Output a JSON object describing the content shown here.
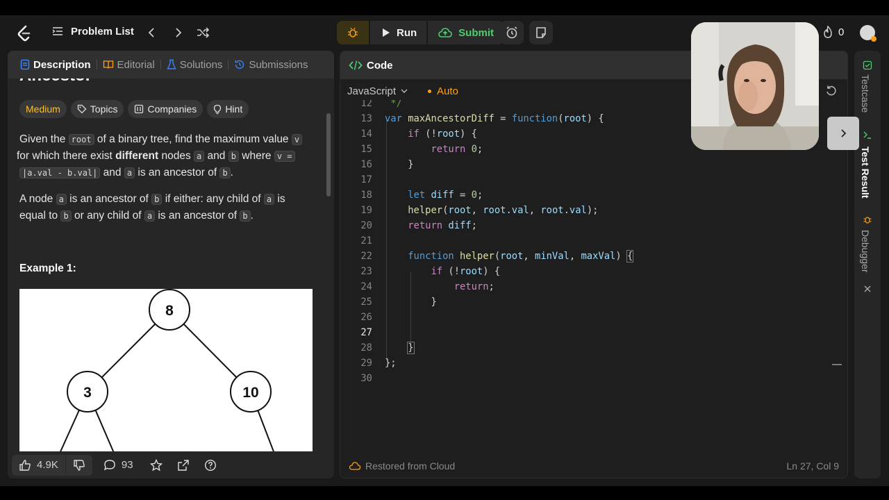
{
  "nav": {
    "problem_list": "Problem List",
    "run": "Run",
    "submit": "Submit",
    "streak": "0"
  },
  "left": {
    "tabs": [
      "Description",
      "Editorial",
      "Solutions",
      "Submissions"
    ],
    "title_partial": "Ancestor",
    "tags": [
      "Medium",
      "Topics",
      "Companies",
      "Hint"
    ],
    "p1": {
      "a": "Given the ",
      "code1": "root",
      "b": " of a binary tree, find the maximum value ",
      "code2": "v",
      "c": " for which there exist ",
      "bold": "different",
      "d": " nodes ",
      "code3": "a",
      "e": " and ",
      "code4": "b",
      "f": " where ",
      "code5": "v =",
      "code6": "|a.val - b.val|",
      "g": " and ",
      "code7": "a",
      "h": " is an ancestor of ",
      "code8": "b",
      "i": "."
    },
    "p2": {
      "a": "A node ",
      "code1": "a",
      "b": " is an ancestor of ",
      "code2": "b",
      "c": " if either: any child of ",
      "code3": "a",
      "d": " is equal to ",
      "code4": "b",
      "e": " or any child of ",
      "code5": "a",
      "f": " is an ancestor of ",
      "code6": "b",
      "g": "."
    },
    "example_label": "Example 1:",
    "tree_nodes": [
      "8",
      "3",
      "10"
    ],
    "footer": {
      "likes": "4.9K",
      "comments": "93"
    }
  },
  "editor": {
    "header": "Code",
    "language": "JavaScript",
    "auto": "Auto",
    "lines": [
      {
        "n": "12",
        "t": " */"
      },
      {
        "n": "13",
        "t": "var maxAncestorDiff = function(root) {"
      },
      {
        "n": "14",
        "t": "    if (!root) {"
      },
      {
        "n": "15",
        "t": "        return 0;"
      },
      {
        "n": "16",
        "t": "    }"
      },
      {
        "n": "17",
        "t": ""
      },
      {
        "n": "18",
        "t": "    let diff = 0;"
      },
      {
        "n": "19",
        "t": "    helper(root, root.val, root.val);"
      },
      {
        "n": "20",
        "t": "    return diff;"
      },
      {
        "n": "21",
        "t": ""
      },
      {
        "n": "22",
        "t": "    function helper(root, minVal, maxVal) {"
      },
      {
        "n": "23",
        "t": "        if (!root) {"
      },
      {
        "n": "24",
        "t": "            return;"
      },
      {
        "n": "25",
        "t": "        }"
      },
      {
        "n": "26",
        "t": ""
      },
      {
        "n": "27",
        "t": ""
      },
      {
        "n": "28",
        "t": "    }"
      },
      {
        "n": "29",
        "t": "};"
      },
      {
        "n": "30",
        "t": ""
      }
    ],
    "status": "Restored from Cloud",
    "cursor": "Ln 27, Col 9"
  },
  "side": {
    "testcase": "Testcase",
    "test_result": "Test Result",
    "debugger": "Debugger"
  },
  "colors": {
    "accent": "#ffa116",
    "submit": "#4ccf6d",
    "medium": "#ffc01e"
  }
}
